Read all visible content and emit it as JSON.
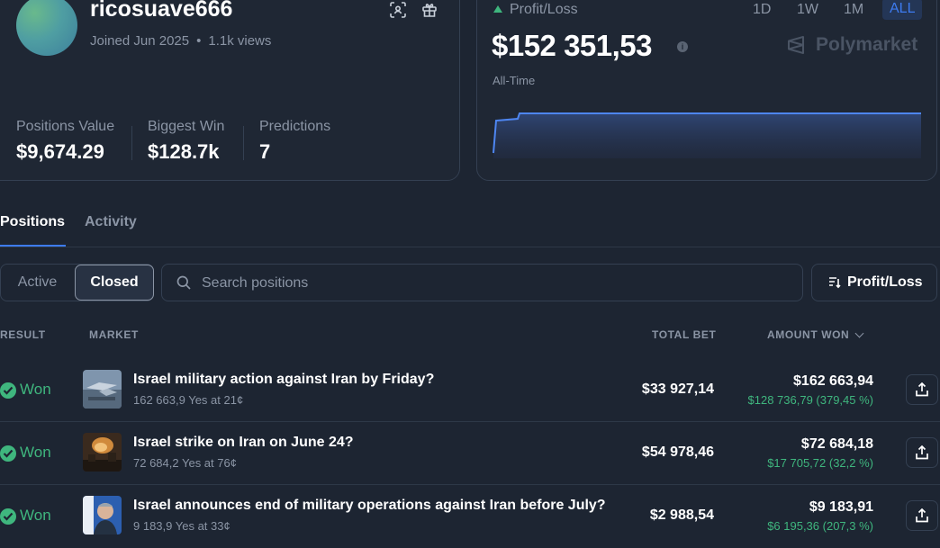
{
  "profile": {
    "username": "ricosuave666",
    "joined": "Joined Jun 2025",
    "views": "1.1k views",
    "stats": [
      {
        "label": "Positions Value",
        "value": "$9,674.29"
      },
      {
        "label": "Biggest Win",
        "value": "$128.7k"
      },
      {
        "label": "Predictions",
        "value": "7"
      }
    ]
  },
  "pnl": {
    "label": "Profit/Loss",
    "value": "$152 351,53",
    "period": "All-Time",
    "ranges": [
      "1D",
      "1W",
      "1M",
      "ALL"
    ],
    "active_range": "ALL",
    "brand": "Polymarket"
  },
  "tabs": [
    "Positions",
    "Activity"
  ],
  "active_tab": "Positions",
  "filters": {
    "active": "Active",
    "closed": "Closed",
    "selected": "Closed"
  },
  "search": {
    "placeholder": "Search positions",
    "value": ""
  },
  "sort": {
    "label": "Profit/Loss"
  },
  "columns": {
    "result": "RESULT",
    "market": "MARKET",
    "total_bet": "TOTAL BET",
    "amount_won": "AMOUNT WON"
  },
  "rows": [
    {
      "result": "Won",
      "title": "Israel military action against Iran by Friday?",
      "subtitle": "162 663,9 Yes at 21¢",
      "total_bet": "$33 927,14",
      "amount_won": "$162 663,94",
      "gain": "$128 736,79 (379,45 %)"
    },
    {
      "result": "Won",
      "title": "Israel strike on Iran on June 24?",
      "subtitle": "72 684,2 Yes at 76¢",
      "total_bet": "$54 978,46",
      "amount_won": "$72 684,18",
      "gain": "$17 705,72 (32,2 %)"
    },
    {
      "result": "Won",
      "title": "Israel announces end of military operations against Iran before July?",
      "subtitle": "9 183,9 Yes at 33¢",
      "total_bet": "$2 988,54",
      "amount_won": "$9 183,91",
      "gain": "$6 195,36 (207,3 %)"
    }
  ],
  "colors": {
    "accent": "#3d7bf0",
    "positive": "#3fb67e",
    "background": "#1d2532"
  }
}
